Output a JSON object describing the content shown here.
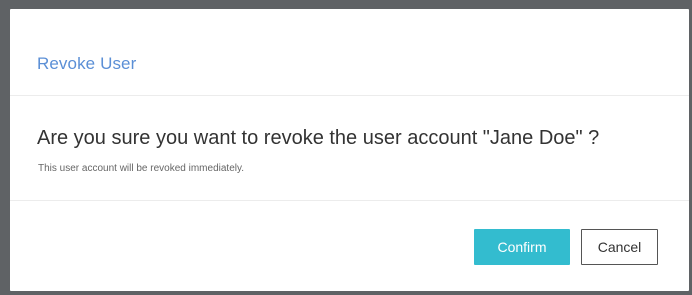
{
  "dialog": {
    "title": "Revoke User",
    "question": "Are you sure you want to revoke the user account \"Jane Doe\" ?",
    "note": "This user account will be revoked immediately.",
    "confirm_label": "Confirm",
    "cancel_label": "Cancel"
  },
  "colors": {
    "title": "#5b8fd6",
    "confirm_button": "#33bccf",
    "backdrop": "#5f6265"
  }
}
